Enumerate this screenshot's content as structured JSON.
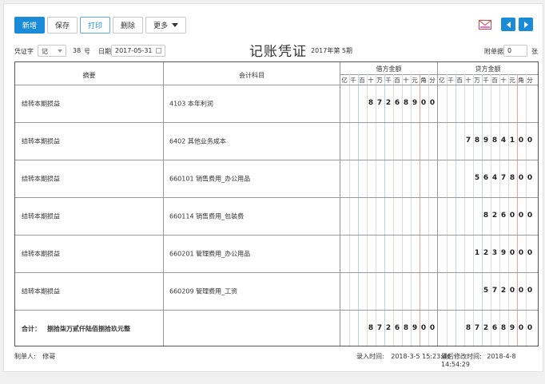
{
  "toolbar": {
    "new_label": "新增",
    "save_label": "保存",
    "print_label": "打印",
    "delete_label": "删除",
    "more_label": "更多"
  },
  "header": {
    "voucher_word_label": "凭证字",
    "voucher_word_value": "记",
    "voucher_no": "38",
    "voucher_no_unit": "号",
    "date_label": "日期",
    "date_value": "2017-05-31",
    "title": "记账凭证",
    "period": "2017年第 5期",
    "attach_label": "附单据",
    "attach_value": "0",
    "attach_unit": "张"
  },
  "table": {
    "col_summary": "摘要",
    "col_account": "会计科目",
    "col_debit": "借方金额",
    "col_credit": "贷方金额",
    "units": [
      "亿",
      "千",
      "百",
      "十",
      "万",
      "千",
      "百",
      "十",
      "元",
      "角",
      "分"
    ],
    "rows": [
      {
        "summary": "结转本期损益",
        "account": "4103 本年利润",
        "debit": "8726890 0",
        "credit": ""
      },
      {
        "summary": "结转本期损益",
        "account": "6402 其他业务成本",
        "debit": "",
        "credit": "789841 00"
      },
      {
        "summary": "结转本期损益",
        "account": "660101 销售费用_办公用品",
        "debit": "",
        "credit": "56478 00"
      },
      {
        "summary": "结转本期损益",
        "account": "660114 销售费用_包装费",
        "debit": "",
        "credit": "8260 00"
      },
      {
        "summary": "结转本期损益",
        "account": "660201 管理费用_办公用品",
        "debit": "",
        "credit": "12390 00"
      },
      {
        "summary": "结转本期损益",
        "account": "660209 管理费用_工资",
        "debit": "",
        "credit": "5720 00"
      }
    ],
    "total_label": "合计：",
    "total_text": "捌拾柒万贰仟陆佰捌拾玖元整",
    "total_debit": "87268900",
    "total_credit": "87268900"
  },
  "footer": {
    "maker_label": "制单人:",
    "maker_value": "修哥",
    "entry_label": "录入时间:",
    "entry_value": "2018-3-5 15:23:46",
    "modified_label": "最后修改时间:",
    "modified_value": "2018-4-8 14:54:29"
  },
  "colors": {
    "primary": "#1a8bd6",
    "red_line": "#f2a0a0",
    "blue_line": "#b9d4ea"
  }
}
